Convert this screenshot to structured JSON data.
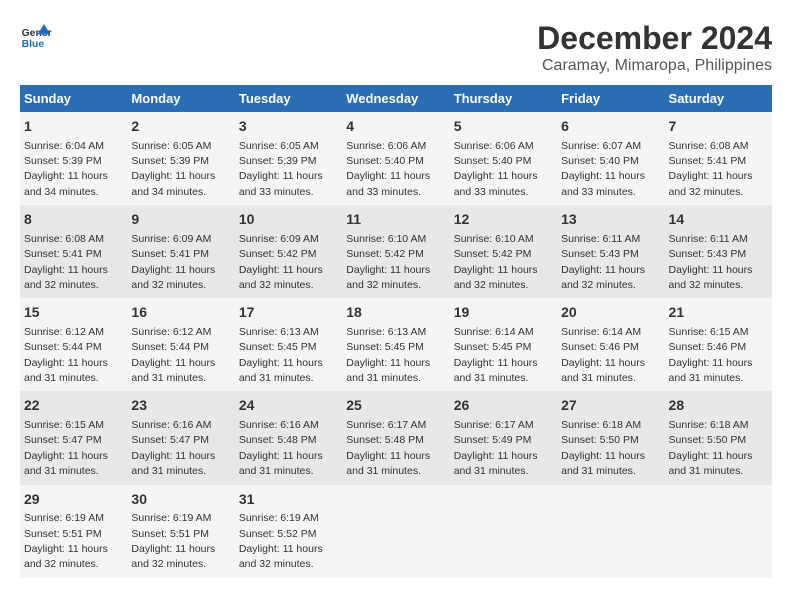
{
  "logo": {
    "line1": "General",
    "line2": "Blue"
  },
  "title": "December 2024",
  "subtitle": "Caramay, Mimaropa, Philippines",
  "headers": [
    "Sunday",
    "Monday",
    "Tuesday",
    "Wednesday",
    "Thursday",
    "Friday",
    "Saturday"
  ],
  "weeks": [
    [
      {
        "day": "1",
        "sunrise": "6:04 AM",
        "sunset": "5:39 PM",
        "daylight": "11 hours and 34 minutes."
      },
      {
        "day": "2",
        "sunrise": "6:05 AM",
        "sunset": "5:39 PM",
        "daylight": "11 hours and 34 minutes."
      },
      {
        "day": "3",
        "sunrise": "6:05 AM",
        "sunset": "5:39 PM",
        "daylight": "11 hours and 33 minutes."
      },
      {
        "day": "4",
        "sunrise": "6:06 AM",
        "sunset": "5:40 PM",
        "daylight": "11 hours and 33 minutes."
      },
      {
        "day": "5",
        "sunrise": "6:06 AM",
        "sunset": "5:40 PM",
        "daylight": "11 hours and 33 minutes."
      },
      {
        "day": "6",
        "sunrise": "6:07 AM",
        "sunset": "5:40 PM",
        "daylight": "11 hours and 33 minutes."
      },
      {
        "day": "7",
        "sunrise": "6:08 AM",
        "sunset": "5:41 PM",
        "daylight": "11 hours and 32 minutes."
      }
    ],
    [
      {
        "day": "8",
        "sunrise": "6:08 AM",
        "sunset": "5:41 PM",
        "daylight": "11 hours and 32 minutes."
      },
      {
        "day": "9",
        "sunrise": "6:09 AM",
        "sunset": "5:41 PM",
        "daylight": "11 hours and 32 minutes."
      },
      {
        "day": "10",
        "sunrise": "6:09 AM",
        "sunset": "5:42 PM",
        "daylight": "11 hours and 32 minutes."
      },
      {
        "day": "11",
        "sunrise": "6:10 AM",
        "sunset": "5:42 PM",
        "daylight": "11 hours and 32 minutes."
      },
      {
        "day": "12",
        "sunrise": "6:10 AM",
        "sunset": "5:42 PM",
        "daylight": "11 hours and 32 minutes."
      },
      {
        "day": "13",
        "sunrise": "6:11 AM",
        "sunset": "5:43 PM",
        "daylight": "11 hours and 32 minutes."
      },
      {
        "day": "14",
        "sunrise": "6:11 AM",
        "sunset": "5:43 PM",
        "daylight": "11 hours and 32 minutes."
      }
    ],
    [
      {
        "day": "15",
        "sunrise": "6:12 AM",
        "sunset": "5:44 PM",
        "daylight": "11 hours and 31 minutes."
      },
      {
        "day": "16",
        "sunrise": "6:12 AM",
        "sunset": "5:44 PM",
        "daylight": "11 hours and 31 minutes."
      },
      {
        "day": "17",
        "sunrise": "6:13 AM",
        "sunset": "5:45 PM",
        "daylight": "11 hours and 31 minutes."
      },
      {
        "day": "18",
        "sunrise": "6:13 AM",
        "sunset": "5:45 PM",
        "daylight": "11 hours and 31 minutes."
      },
      {
        "day": "19",
        "sunrise": "6:14 AM",
        "sunset": "5:45 PM",
        "daylight": "11 hours and 31 minutes."
      },
      {
        "day": "20",
        "sunrise": "6:14 AM",
        "sunset": "5:46 PM",
        "daylight": "11 hours and 31 minutes."
      },
      {
        "day": "21",
        "sunrise": "6:15 AM",
        "sunset": "5:46 PM",
        "daylight": "11 hours and 31 minutes."
      }
    ],
    [
      {
        "day": "22",
        "sunrise": "6:15 AM",
        "sunset": "5:47 PM",
        "daylight": "11 hours and 31 minutes."
      },
      {
        "day": "23",
        "sunrise": "6:16 AM",
        "sunset": "5:47 PM",
        "daylight": "11 hours and 31 minutes."
      },
      {
        "day": "24",
        "sunrise": "6:16 AM",
        "sunset": "5:48 PM",
        "daylight": "11 hours and 31 minutes."
      },
      {
        "day": "25",
        "sunrise": "6:17 AM",
        "sunset": "5:48 PM",
        "daylight": "11 hours and 31 minutes."
      },
      {
        "day": "26",
        "sunrise": "6:17 AM",
        "sunset": "5:49 PM",
        "daylight": "11 hours and 31 minutes."
      },
      {
        "day": "27",
        "sunrise": "6:18 AM",
        "sunset": "5:50 PM",
        "daylight": "11 hours and 31 minutes."
      },
      {
        "day": "28",
        "sunrise": "6:18 AM",
        "sunset": "5:50 PM",
        "daylight": "11 hours and 31 minutes."
      }
    ],
    [
      {
        "day": "29",
        "sunrise": "6:19 AM",
        "sunset": "5:51 PM",
        "daylight": "11 hours and 32 minutes."
      },
      {
        "day": "30",
        "sunrise": "6:19 AM",
        "sunset": "5:51 PM",
        "daylight": "11 hours and 32 minutes."
      },
      {
        "day": "31",
        "sunrise": "6:19 AM",
        "sunset": "5:52 PM",
        "daylight": "11 hours and 32 minutes."
      },
      null,
      null,
      null,
      null
    ]
  ],
  "labels": {
    "sunrise": "Sunrise:",
    "sunset": "Sunset:",
    "daylight": "Daylight:"
  }
}
